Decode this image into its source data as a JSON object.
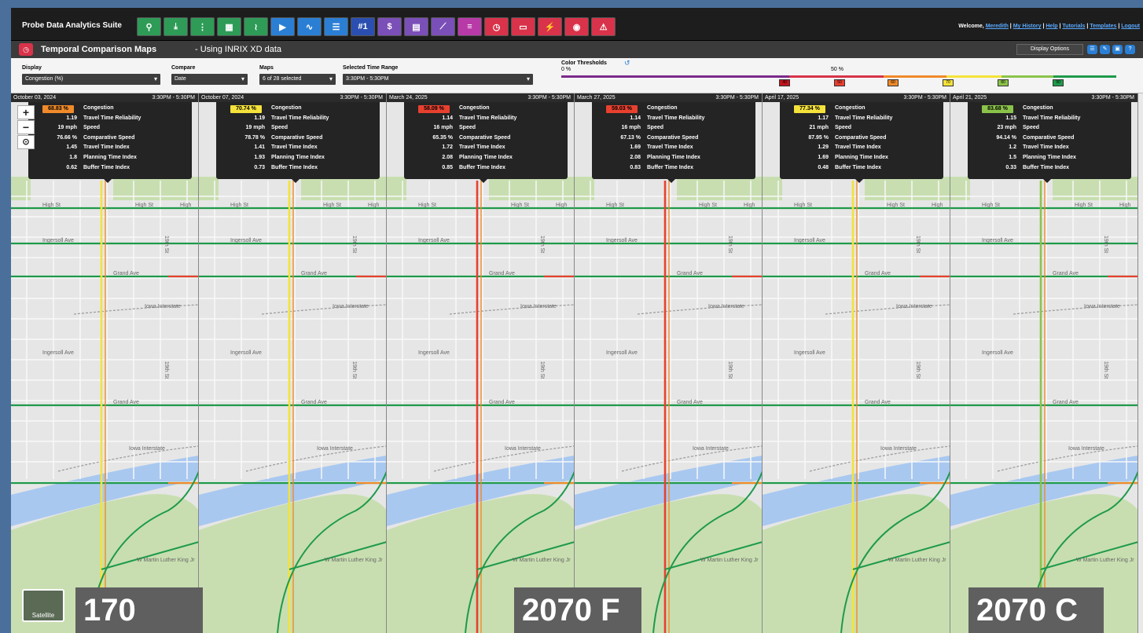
{
  "header": {
    "app_title": "Probe Data Analytics Suite",
    "tools": [
      {
        "icon": "magnifier-icon",
        "color": "#2e9b57",
        "glyph": "⚲"
      },
      {
        "icon": "download-icon",
        "color": "#2e9b57",
        "glyph": "⤓"
      },
      {
        "icon": "corridor-icon",
        "color": "#2e9b57",
        "glyph": "⋮"
      },
      {
        "icon": "heatmap-icon",
        "color": "#2e9b57",
        "glyph": "▦"
      },
      {
        "icon": "route-icon",
        "color": "#2e9b57",
        "glyph": "≀"
      },
      {
        "icon": "play-icon",
        "color": "#2a7fd4",
        "glyph": "▶"
      },
      {
        "icon": "trend-icon",
        "color": "#2a7fd4",
        "glyph": "∿"
      },
      {
        "icon": "list-icon",
        "color": "#2a7fd4",
        "glyph": "☰"
      },
      {
        "icon": "rank-icon",
        "color": "#2a4fb0",
        "glyph": "#1"
      },
      {
        "icon": "cost-icon",
        "color": "#7b4fb8",
        "glyph": "$"
      },
      {
        "icon": "table-icon",
        "color": "#7b4fb8",
        "glyph": "▤"
      },
      {
        "icon": "network-icon",
        "color": "#7b4fb8",
        "glyph": "⟋"
      },
      {
        "icon": "bars-icon",
        "color": "#b83aa8",
        "glyph": "≡"
      },
      {
        "icon": "clock-icon",
        "color": "#d8334a",
        "glyph": "◷"
      },
      {
        "icon": "bus-icon",
        "color": "#d8334a",
        "glyph": "▭"
      },
      {
        "icon": "incident-icon",
        "color": "#d8334a",
        "glyph": "⚡"
      },
      {
        "icon": "gauge-icon",
        "color": "#d8334a",
        "glyph": "◉"
      },
      {
        "icon": "alert-icon",
        "color": "#d8334a",
        "glyph": "⚠"
      }
    ],
    "welcome_text": "Welcome, ",
    "user": "Meredith",
    "links": [
      "My History",
      "Help",
      "Tutorials",
      "Templates",
      "Logout"
    ],
    "separator": " | "
  },
  "subheader": {
    "title": "Temporal Comparison Maps",
    "subtitle": " - Using INRIX XD data",
    "display_options": "Display Options"
  },
  "controls": {
    "display_label": "Display",
    "display_value": "Congestion (%)",
    "compare_label": "Compare",
    "compare_value": "Date",
    "maps_label": "Maps",
    "maps_value": "6 of 28 selected",
    "range_label": "Selected Time Range",
    "range_value": "3:30PM - 5:30PM",
    "thresholds_label": "Color Thresholds",
    "thr_start": "0 %",
    "thr_mid": "50 %",
    "thr_marks": [
      "40",
      "50",
      "60",
      "70",
      "80",
      "90"
    ],
    "thr_colors": [
      "#c0141c",
      "#e8402f",
      "#f08a2a",
      "#f5e23a",
      "#8bc34a",
      "#1e9a4a"
    ]
  },
  "stat_labels": [
    "Congestion",
    "Travel Time Reliability",
    "Speed",
    "Comparative Speed",
    "Travel Time Index",
    "Planning Time Index",
    "Buffer Time Index"
  ],
  "panels": [
    {
      "date": "October 03, 2024",
      "time": "3:30PM - 5:30PM",
      "badge_color": "#f08a2a",
      "values": [
        "68.83 %",
        "1.19",
        "19 mph",
        "76.66 %",
        "1.45",
        "1.8",
        "0.62"
      ]
    },
    {
      "date": "October 07, 2024",
      "time": "3:30PM - 5:30PM",
      "badge_color": "#f5e23a",
      "values": [
        "70.74 %",
        "1.19",
        "19 mph",
        "78.78 %",
        "1.41",
        "1.93",
        "0.73"
      ]
    },
    {
      "date": "March 24, 2025",
      "time": "3:30PM - 5:30PM",
      "badge_color": "#e8402f",
      "values": [
        "58.09 %",
        "1.14",
        "16 mph",
        "65.35 %",
        "1.72",
        "2.08",
        "0.85"
      ]
    },
    {
      "date": "March 27, 2025",
      "time": "3:30PM - 5:30PM",
      "badge_color": "#e8402f",
      "values": [
        "59.03 %",
        "1.14",
        "16 mph",
        "67.13 %",
        "1.69",
        "2.08",
        "0.83"
      ]
    },
    {
      "date": "April 17, 2025",
      "time": "3:30PM - 5:30PM",
      "badge_color": "#f5e23a",
      "values": [
        "77.34 %",
        "1.17",
        "21 mph",
        "87.95 %",
        "1.29",
        "1.69",
        "0.48"
      ]
    },
    {
      "date": "April 21, 2025",
      "time": "3:30PM - 5:30PM",
      "badge_color": "#8bc34a",
      "values": [
        "83.68 %",
        "1.15",
        "23 mph",
        "94.14 %",
        "1.2",
        "1.5",
        "0.33"
      ]
    }
  ],
  "map_labels": {
    "high_st": "High St",
    "high_st_short": "High",
    "ingersoll": "Ingersoll Ave",
    "grand": "Grand Ave",
    "interstate": "Iowa Interstate",
    "nineteenth": "19th St",
    "mlk": "W Martin Luther King Jr"
  },
  "zoom": {
    "in": "+",
    "out": "−",
    "locate": "⊙"
  },
  "satellite_label": "Satellite",
  "captions": [
    "170",
    "2070 F",
    "2070 C"
  ]
}
